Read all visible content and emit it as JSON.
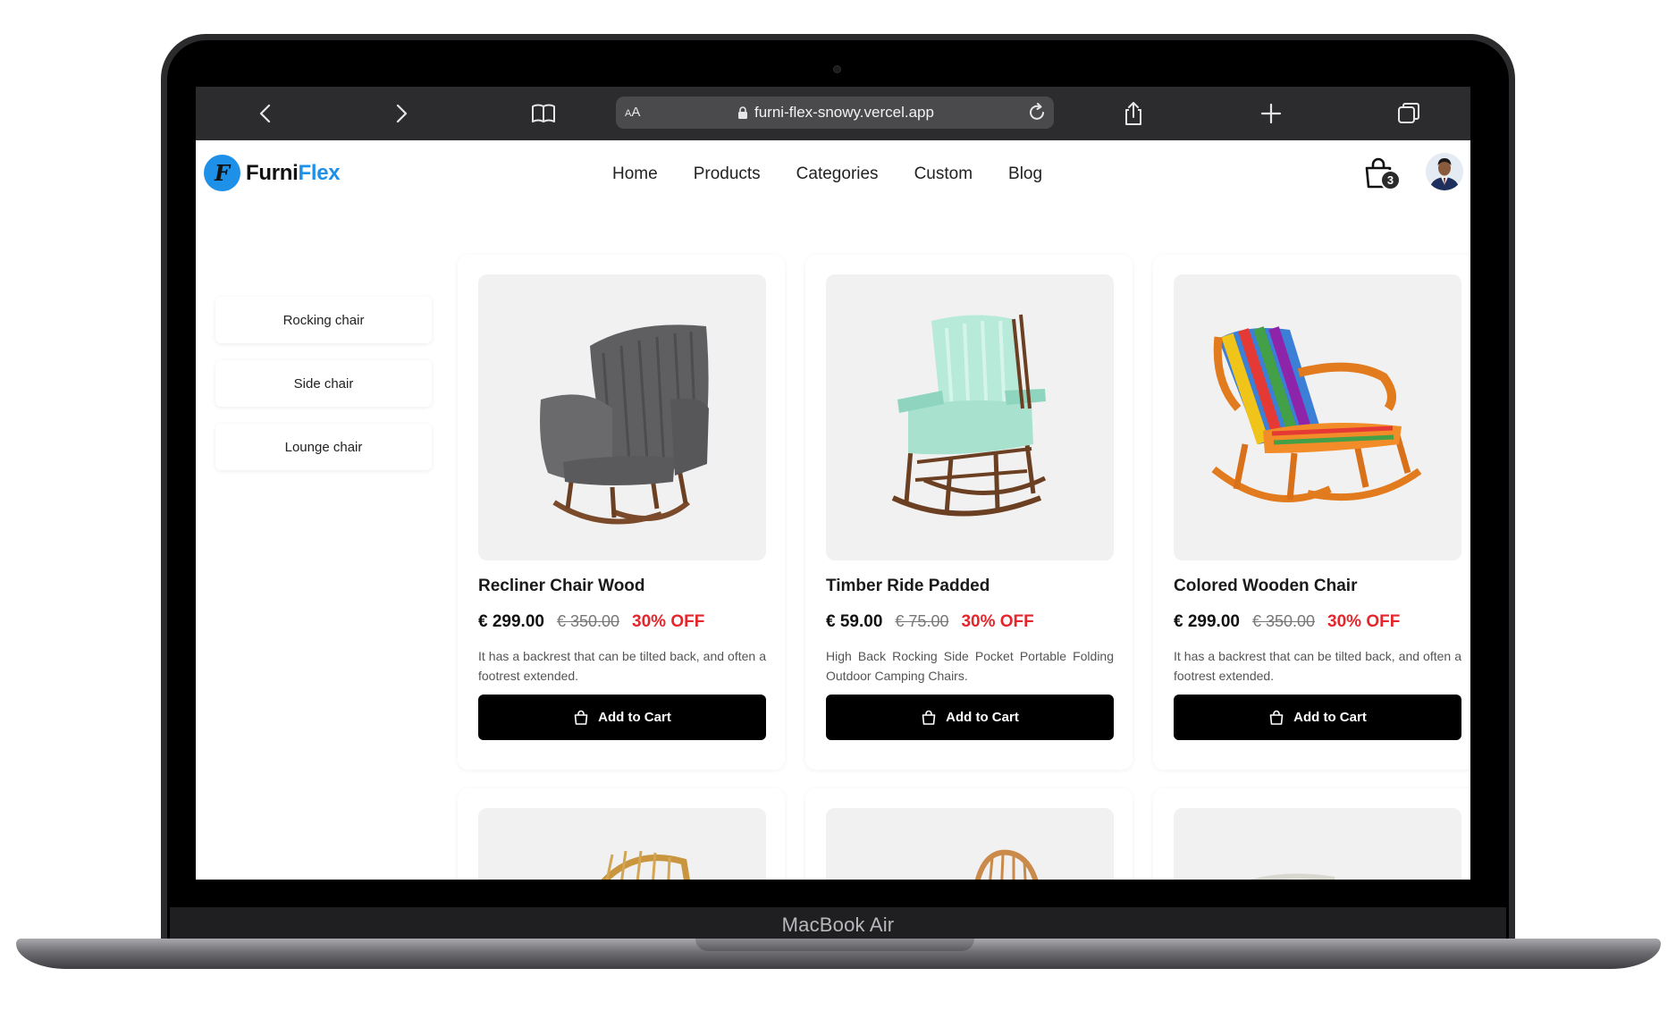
{
  "device": {
    "label": "MacBook Air"
  },
  "browser": {
    "aa_label": "AA",
    "url": "furni-flex-snowy.vercel.app"
  },
  "site": {
    "logo_prefix": "Furni",
    "logo_accent": "Flex",
    "logo_mark": "F",
    "brand_color": "#1e90e8",
    "nav": [
      "Home",
      "Products",
      "Categories",
      "Custom",
      "Blog"
    ],
    "cart_count": "3"
  },
  "sidebar": {
    "items": [
      "Rocking chair",
      "Side chair",
      "Lounge chair"
    ]
  },
  "products": [
    {
      "name": "Recliner Chair Wood",
      "price": "€ 299.00",
      "old_price": "€ 350.00",
      "discount": "30% OFF",
      "description": "It has a backrest that can be tilted back, and often a footrest extended.",
      "button": "Add to Cart"
    },
    {
      "name": "Timber Ride Padded",
      "price": "€ 59.00",
      "old_price": "€ 75.00",
      "discount": "30% OFF",
      "description": "High Back Rocking Side Pocket Portable Folding Outdoor Camping Chairs.",
      "button": "Add to Cart"
    },
    {
      "name": "Colored Wooden Chair",
      "price": "€ 299.00",
      "old_price": "€ 350.00",
      "discount": "30% OFF",
      "description": "It has a backrest that can be tilted back, and often a footrest extended.",
      "button": "Add to Cart"
    }
  ],
  "colors": {
    "discount": "#e5262c",
    "button_bg": "#000000"
  }
}
